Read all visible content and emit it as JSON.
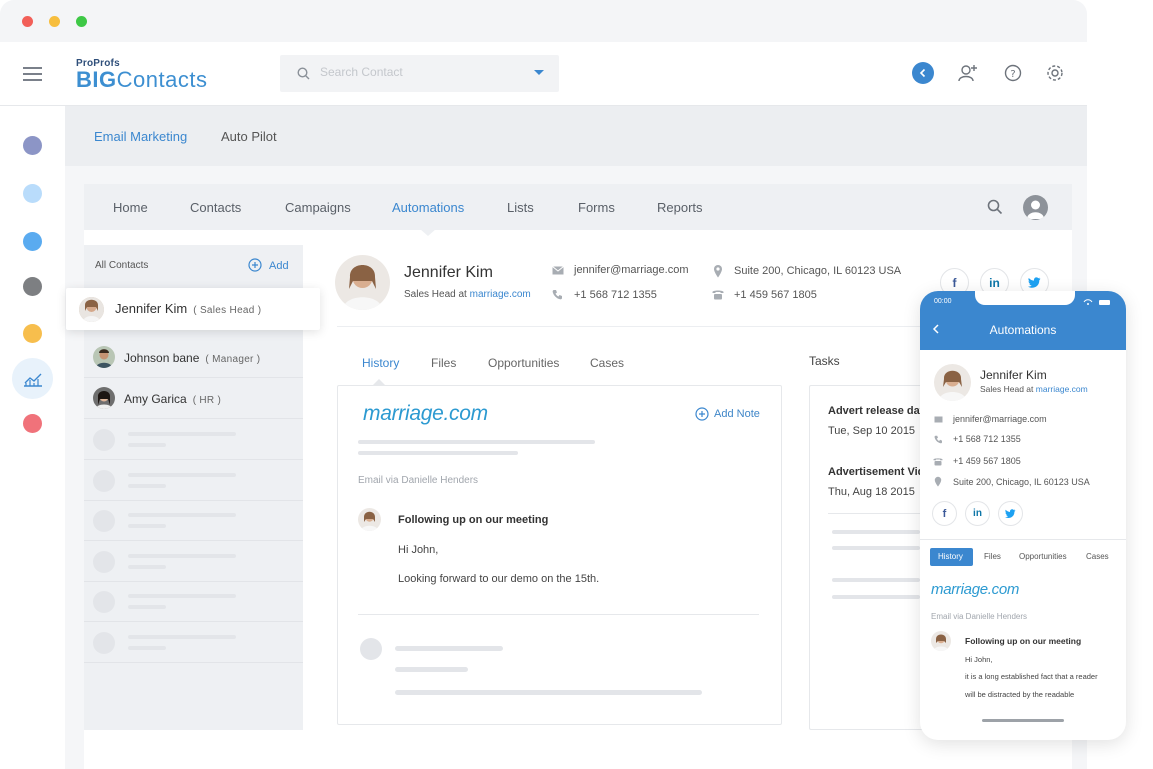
{
  "app": {
    "logo_top": "ProProfs",
    "logo_main_a": "BIG",
    "logo_main_b": "Contacts"
  },
  "search": {
    "placeholder": "Search Contact"
  },
  "top_tabs": [
    "Email Marketing",
    "Auto Pilot"
  ],
  "nav": [
    "Home",
    "Contacts",
    "Campaigns",
    "Automations",
    "Lists",
    "Forms",
    "Reports"
  ],
  "sidebar": {
    "title": "All Contacts",
    "add_label": "Add",
    "contacts": [
      {
        "name": "Jennifer Kim",
        "role": "( Sales Head )"
      },
      {
        "name": "Johnson bane",
        "role": "( Manager )"
      },
      {
        "name": "Amy Garica",
        "role": "( HR )"
      }
    ]
  },
  "profile": {
    "name": "Jennifer Kim",
    "title_prefix": "Sales Head at",
    "company": "marriage.com",
    "email": "jennifer@marriage.com",
    "phone": "+1 568 712 1355",
    "address": "Suite 200, Chicago, IL 60123 USA",
    "landline": "+1 459 567 1805"
  },
  "tabs": [
    "History",
    "Files",
    "Opportunities",
    "Cases"
  ],
  "history": {
    "brand": "marriage.com",
    "add_note": "Add Note",
    "email_via": "Email via Danielle Henders",
    "subject": "Following up on our meeting",
    "greeting": "Hi John,",
    "body": "Looking forward to our demo on the 15th."
  },
  "tasks": {
    "title": "Tasks",
    "items": [
      {
        "title": "Advert release date",
        "date": "Tue, Sep 10 2015"
      },
      {
        "title": "Advertisement Vid",
        "date": "Thu, Aug 18 2015"
      }
    ]
  },
  "phone": {
    "time": "00:00",
    "title": "Automations",
    "name": "Jennifer Kim",
    "title_prefix": "Sales Head at",
    "company": "marriage.com",
    "email": "jennifer@marriage.com",
    "phone": "+1 568 712 1355",
    "landline": "+1 459 567 1805",
    "address": "Suite 200, Chicago, IL 60123 USA",
    "tabs": [
      "History",
      "Files",
      "Opportunities",
      "Cases"
    ],
    "brand": "marriage.com",
    "email_via": "Email via Danielle Henders",
    "subject": "Following up on our meeting",
    "greeting": "Hi John,",
    "line1": "it is a long established fact that a reader",
    "line2": "will be distracted by the readable"
  },
  "colors": {
    "accent": "#3d8fd1",
    "rail": [
      "#8c95c6",
      "#b9dcfb",
      "#5aabf0",
      "#7d7f82",
      "#f7be4d",
      "#f0727a"
    ]
  }
}
